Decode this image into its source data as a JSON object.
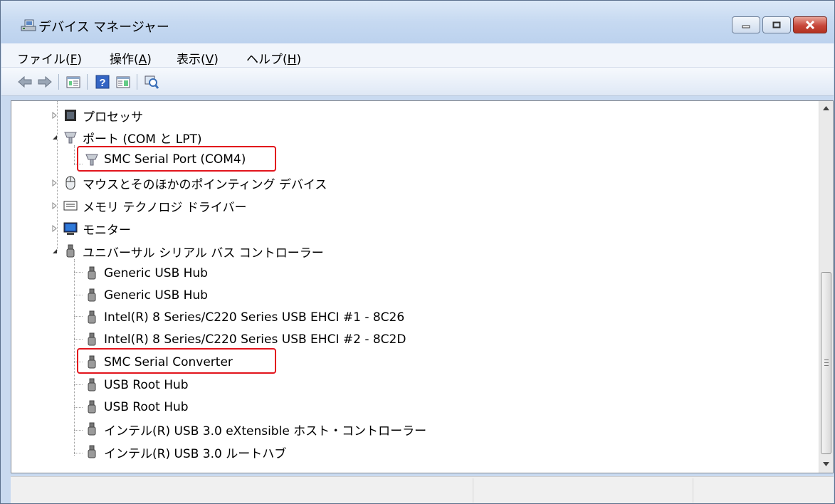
{
  "window": {
    "title": "デバイス マネージャー",
    "title_icon": "device-manager-icon",
    "controls": [
      "minimize-icon",
      "maximize-icon",
      "close-icon"
    ]
  },
  "menu": {
    "items": [
      {
        "label_main": "ファイル(",
        "accel": "F",
        "label_end": ")"
      },
      {
        "label_main": "操作(",
        "accel": "A",
        "label_end": ")"
      },
      {
        "label_main": "表示(",
        "accel": "V",
        "label_end": ")"
      },
      {
        "label_main": "ヘルプ(",
        "accel": "H",
        "label_end": ")"
      }
    ]
  },
  "toolbar": {
    "buttons": [
      "back-arrow-icon",
      "forward-arrow-icon",
      "properties-icon",
      "help-icon",
      "action-pane-icon",
      "scan-hardware-icon"
    ]
  },
  "tree": {
    "nodes": [
      {
        "label": "プロセッサ",
        "icon": "processor-icon",
        "expander": "collapsed"
      },
      {
        "label": "ポート (COM と LPT)",
        "icon": "port-icon",
        "expander": "expanded"
      },
      {
        "label": "SMC Serial Port (COM4)",
        "icon": "port-icon",
        "highlighted": true
      },
      {
        "label": "マウスとそのほかのポインティング デバイス",
        "icon": "mouse-icon",
        "expander": "collapsed"
      },
      {
        "label": "メモリ テクノロジ ドライバー",
        "icon": "memory-icon",
        "expander": "collapsed"
      },
      {
        "label": "モニター",
        "icon": "monitor-icon",
        "expander": "collapsed"
      },
      {
        "label": "ユニバーサル シリアル バス コントローラー",
        "icon": "usb-icon",
        "expander": "expanded"
      },
      {
        "label": "Generic USB Hub",
        "icon": "usb-icon"
      },
      {
        "label": "Generic USB Hub",
        "icon": "usb-icon"
      },
      {
        "label": "Intel(R) 8 Series/C220 Series USB EHCI #1 - 8C26",
        "icon": "usb-icon"
      },
      {
        "label": "Intel(R) 8 Series/C220 Series USB EHCI #2 - 8C2D",
        "icon": "usb-icon"
      },
      {
        "label": "SMC Serial Converter",
        "icon": "usb-icon",
        "highlighted": true
      },
      {
        "label": "USB Root Hub",
        "icon": "usb-icon"
      },
      {
        "label": "USB Root Hub",
        "icon": "usb-icon"
      },
      {
        "label": "インテル(R) USB 3.0 eXtensible ホスト・コントローラー",
        "icon": "usb-icon"
      },
      {
        "label": "インテル(R) USB 3.0 ルートハブ",
        "icon": "usb-icon"
      }
    ],
    "highlight_color": "#e2141c"
  },
  "colors": {
    "frame": "#c9daf0",
    "close_button": "#c7473a"
  }
}
